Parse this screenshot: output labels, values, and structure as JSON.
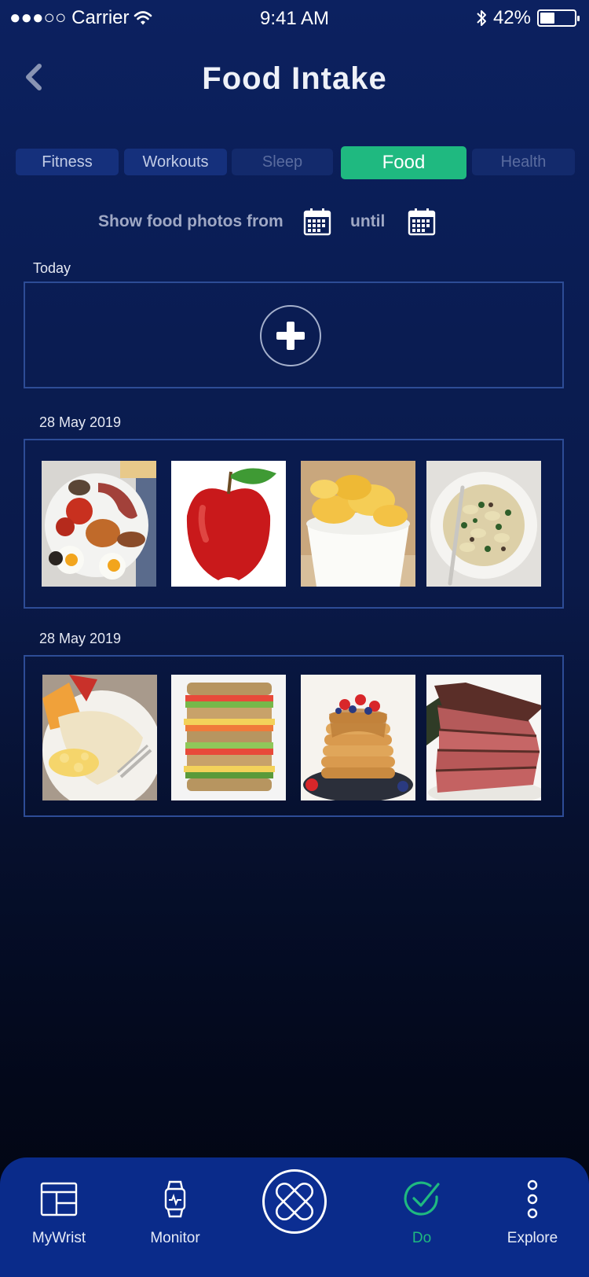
{
  "status_bar": {
    "carrier": "●●●○○ Carrier",
    "time": "9:41 AM",
    "battery_pct": "42%",
    "battery_level": 0.42
  },
  "header": {
    "title": "Food Intake"
  },
  "tabs": [
    {
      "label": "Fitness",
      "state": "normal"
    },
    {
      "label": "Workouts",
      "state": "normal"
    },
    {
      "label": "Sleep",
      "state": "dim"
    },
    {
      "label": "Food",
      "state": "active"
    },
    {
      "label": "Health",
      "state": "dim"
    }
  ],
  "filter": {
    "label": "Show food photos from",
    "until": "until"
  },
  "sections": [
    {
      "date": "Today"
    },
    {
      "date": "28 May 2019",
      "photos": [
        "full-breakfast",
        "red-apple",
        "potato-chips",
        "bowtie-pasta"
      ]
    },
    {
      "date": "28 May 2019",
      "photos": [
        "breakfast-burrito",
        "stacked-sandwich",
        "pancake-stack",
        "sliced-steak"
      ]
    }
  ],
  "bottom_nav": [
    {
      "label": "MyWrist",
      "icon": "layout-icon"
    },
    {
      "label": "Monitor",
      "icon": "watch-icon"
    },
    {
      "label": "Do",
      "icon": "check-circle-icon",
      "active": true
    },
    {
      "label": "Explore",
      "icon": "more-vertical-icon"
    }
  ],
  "colors": {
    "accent": "#1fb980",
    "tab_bg": "#15307c",
    "nav_bg": "#0a2b8a",
    "box_border": "#2d4c96"
  }
}
